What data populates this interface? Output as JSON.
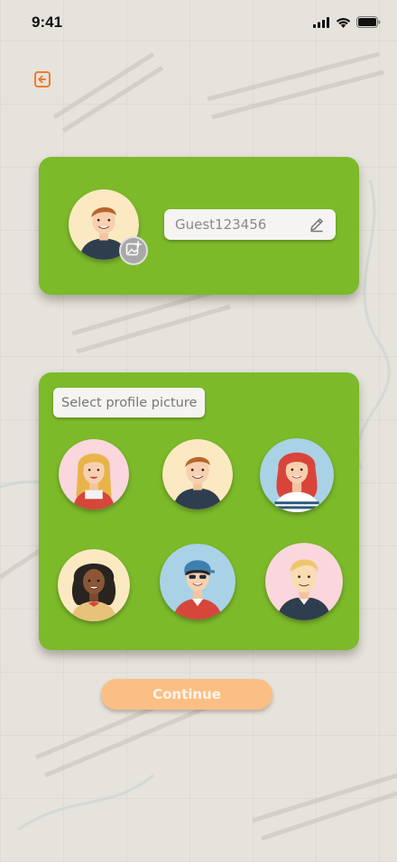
{
  "status_bar": {
    "time": "9:41"
  },
  "profile": {
    "username_value": "Guest123456",
    "username_placeholder": "Guest123456"
  },
  "picker": {
    "title": "Select profile picture",
    "avatars": [
      {
        "label": "blonde-woman",
        "bg": "#f9d7dc"
      },
      {
        "label": "brown-hair-man",
        "bg": "#fbe9c2"
      },
      {
        "label": "red-hair-woman",
        "bg": "#a9d2e6"
      },
      {
        "label": "curly-black-hair-woman",
        "bg": "#fbe9c2"
      },
      {
        "label": "blue-cap-boy",
        "bg": "#a9d2e6"
      },
      {
        "label": "blonde-man",
        "bg": "#f9d7dc"
      }
    ]
  },
  "actions": {
    "continue_label": "Continue"
  },
  "colors": {
    "card_green": "#7cba2a",
    "continue_orange": "#fbbf85",
    "back_icon_orange": "#f07c2a",
    "background": "#e6e2dc"
  }
}
